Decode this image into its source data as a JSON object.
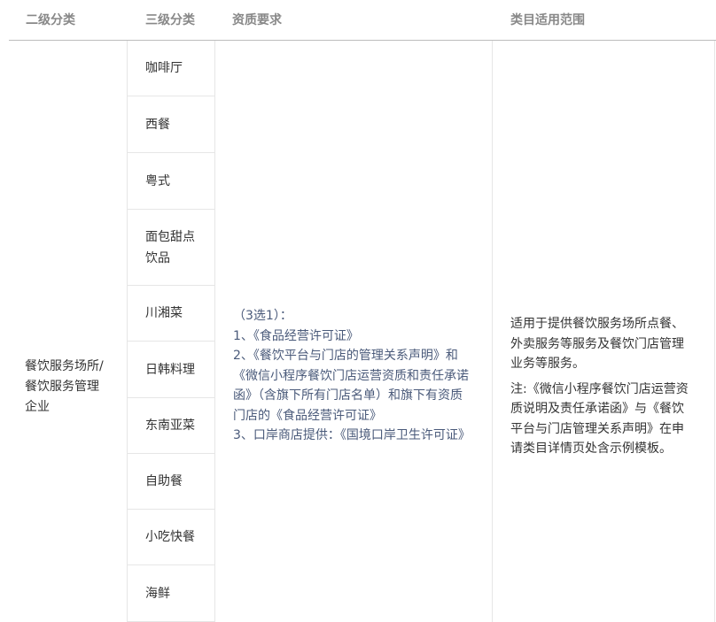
{
  "headers": {
    "level2": "二级分类",
    "level3": "三级分类",
    "requirement": "资质要求",
    "scope": "类目适用范围"
  },
  "row": {
    "level2_lines": [
      "餐饮服务场所/",
      "餐饮服务管理",
      "企业"
    ],
    "level3_items": [
      "咖啡厅",
      "西餐",
      "粤式",
      "面包甜点饮品",
      "川湘菜",
      "日韩料理",
      "东南亚菜",
      "自助餐",
      "小吃快餐",
      "海鲜"
    ],
    "requirement_lines": [
      "（3选1）：",
      "1、《食品经营许可证》",
      "2、《餐饮平台与门店的管理关系声明》和《微信小程序餐饮门店运营资质和责任承诺函》（含旗下所有门店名单）和旗下有资质门店的《食品经营许可证》",
      "3、口岸商店提供：《国境口岸卫生许可证》"
    ],
    "scope_text": "适用于提供餐饮服务场所点餐、外卖服务等服务及餐饮门店管理业务等服务。",
    "scope_note": "注:《微信小程序餐饮门店运营资质说明及责任承诺函》与《餐饮平台与门店管理关系声明》在申请类目详情页处含示例模板。"
  }
}
